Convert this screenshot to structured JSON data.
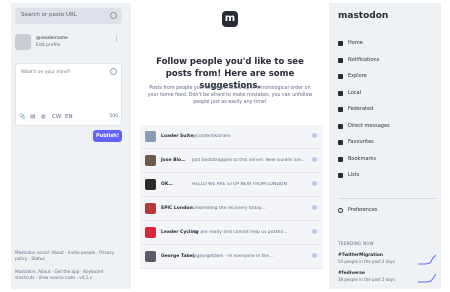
{
  "search": {
    "placeholder": "Search or paste URL"
  },
  "profile": {
    "display_name": "@readername",
    "edit_label": "Edit profile"
  },
  "compose": {
    "placeholder": "What's on your mind?",
    "char_count": "500",
    "publish_label": "Publish!"
  },
  "left_footer": {
    "line1": "Mastodon.social: About · Invite people · Privacy policy · Status",
    "line2": "Mastodon: About · Get the app · Keyboard shortcuts · View source code · v4.1.x"
  },
  "center": {
    "headline": "Follow people you'd like to see posts from! Here are some suggestions.",
    "description": "Posts from people you follow will show up in chronological order on your home feed. Don't be afraid to make mistakes, you can unfollow people just as easily any time!",
    "rows": [
      {
        "name": "Loader Suite",
        "text": "@contentwarden",
        "color": "#8a9bb8"
      },
      {
        "name": "Jose Blo…",
        "text": "Just bootstrapped to this server. New Guides are...",
        "color": "#6e5a4a"
      },
      {
        "name": "OK…",
        "text": "HELLO WE ARE STOP NEW FROM LONDON",
        "color": "#2a2a2a"
      },
      {
        "name": "EPIC London",
        "text": "Embedding the recovery today...",
        "color": "#b23a3a"
      },
      {
        "name": "Leader Cycling",
        "text": "We are ready and cannot help us posted...",
        "color": "#d9263a"
      },
      {
        "name": "George Takei",
        "text": "@georgetakei · Hi everyone in the...",
        "color": "#5a5a6a"
      }
    ]
  },
  "right": {
    "brand": "mastodon",
    "nav": [
      {
        "label": "Home",
        "icon": "home-icon"
      },
      {
        "label": "Notifications",
        "icon": "bell-icon"
      },
      {
        "label": "Explore",
        "icon": "hashtag-icon"
      },
      {
        "label": "Local",
        "icon": "users-icon"
      },
      {
        "label": "Federated",
        "icon": "globe-icon"
      },
      {
        "label": "Direct messages",
        "icon": "at-icon"
      },
      {
        "label": "Favourites",
        "icon": "star-icon"
      },
      {
        "label": "Bookmarks",
        "icon": "bookmark-icon"
      },
      {
        "label": "Lists",
        "icon": "list-icon"
      }
    ],
    "preferences_label": "Preferences",
    "trending_header": "TRENDING NOW",
    "trends": [
      {
        "tag": "#TwitterMigration",
        "stat": "54 people in the past 2 days"
      },
      {
        "tag": "#fediverse",
        "stat": "38 people in the past 2 days"
      }
    ]
  },
  "colors": {
    "accent": "#6364ff",
    "text": "#282c37",
    "muted": "#606984",
    "bg": "#eff2f5"
  }
}
